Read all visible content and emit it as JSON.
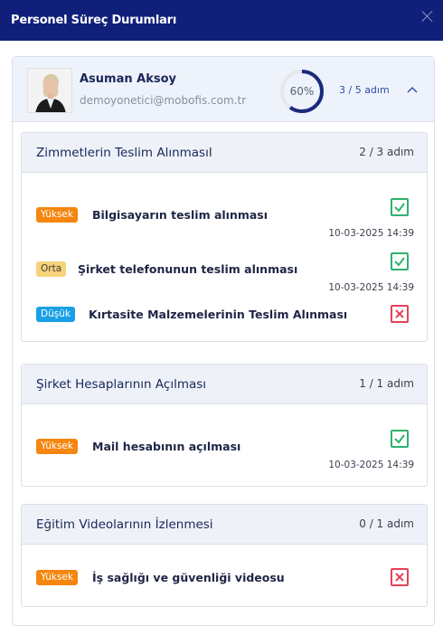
{
  "header": {
    "title": "Personel Süreç Durumları"
  },
  "person": {
    "name": "Asuman Aksoy",
    "email": "demoyonetici@mobofis.com.tr",
    "progress_percent": 60,
    "progress_label": "60%",
    "steps": "3 / 5 adım"
  },
  "colors": {
    "header": "#0f1f7a",
    "accent": "#2f4aa8",
    "done": "#2fb170",
    "fail": "#e54255",
    "priority_high": "#f5860f",
    "priority_mid": "#f6d37a",
    "priority_low": "#1aa0e6"
  },
  "sections": [
    {
      "title": "Zimmetlerin Teslim Alınmasıl",
      "steps": "2 / 3 adım",
      "tasks": [
        {
          "priority": "Yüksek",
          "title": "Bilgisayarın teslim alınması",
          "status": "done",
          "date": "10-03-2025 14:39"
        },
        {
          "priority": "Orta",
          "title": "Şirket telefonunun teslim alınması",
          "status": "done",
          "date": "10-03-2025 14:39"
        },
        {
          "priority": "Düşük",
          "title": "Kırtasite Malzemelerinin Teslim Alınması",
          "status": "not-done"
        }
      ]
    },
    {
      "title": "Şirket Hesaplarının Açılması",
      "steps": "1 / 1 adım",
      "tasks": [
        {
          "priority": "Yüksek",
          "title": "Mail hesabının açılması",
          "status": "done",
          "date": "10-03-2025 14:39"
        }
      ]
    },
    {
      "title": "Eğitim Videolarının İzlenmesi",
      "steps": "0 / 1 adım",
      "tasks": [
        {
          "priority": "Yüksek",
          "title": "İş sağlığı ve güvenliği videosu",
          "status": "not-done"
        }
      ]
    }
  ]
}
